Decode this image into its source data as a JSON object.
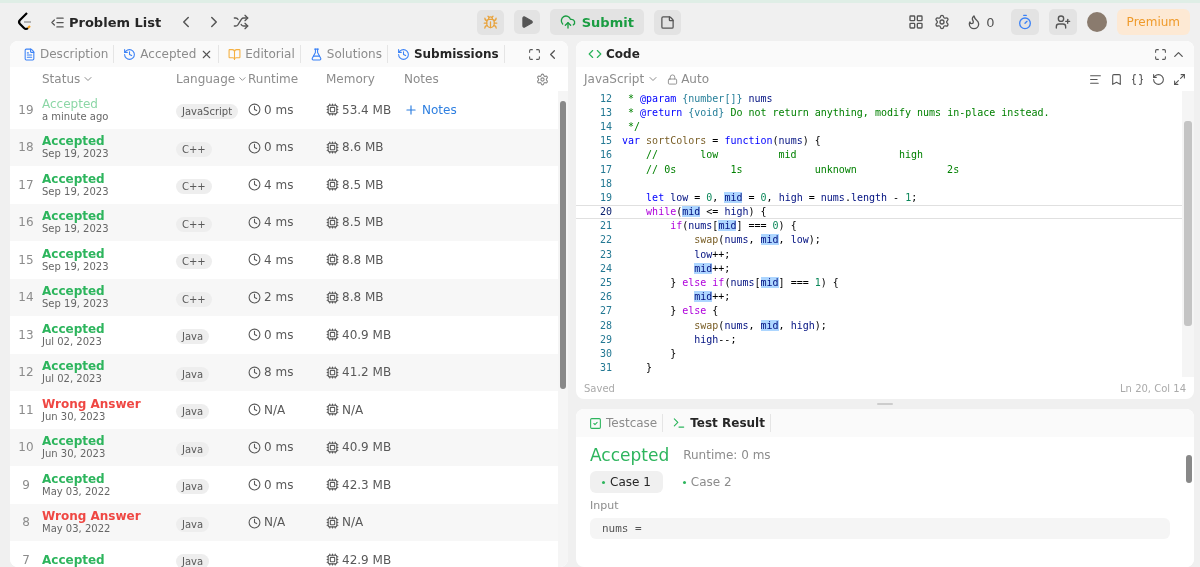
{
  "topbar": {
    "title": "Problem List",
    "submit": "Submit",
    "streak": "0",
    "premium": "Premium"
  },
  "left_panel": {
    "tabs": [
      {
        "label": "Description",
        "selected": false,
        "closable": false
      },
      {
        "label": "Accepted",
        "selected": false,
        "closable": true
      },
      {
        "label": "Editorial",
        "selected": false,
        "closable": false
      },
      {
        "label": "Solutions",
        "selected": false,
        "closable": false
      },
      {
        "label": "Submissions",
        "selected": true,
        "closable": false
      }
    ],
    "columns": [
      {
        "label": "Status",
        "sortable": true
      },
      {
        "label": "Language",
        "sortable": true
      },
      {
        "label": "Runtime",
        "sortable": false
      },
      {
        "label": "Memory",
        "sortable": false
      },
      {
        "label": "Notes",
        "sortable": false
      }
    ],
    "rows": [
      {
        "index": "19",
        "status": "Accepted",
        "kind": "accepted",
        "date": "a minute ago",
        "language": "JavaScript",
        "runtime": "0 ms",
        "memory": "53.4 MB",
        "notes": "Notes",
        "selected": true
      },
      {
        "index": "18",
        "status": "Accepted",
        "kind": "accepted",
        "date": "Sep 19, 2023",
        "language": "C++",
        "runtime": "0 ms",
        "memory": "8.6 MB",
        "selected": false
      },
      {
        "index": "17",
        "status": "Accepted",
        "kind": "accepted",
        "date": "Sep 19, 2023",
        "language": "C++",
        "runtime": "4 ms",
        "memory": "8.5 MB",
        "selected": false
      },
      {
        "index": "16",
        "status": "Accepted",
        "kind": "accepted",
        "date": "Sep 19, 2023",
        "language": "C++",
        "runtime": "4 ms",
        "memory": "8.5 MB",
        "selected": false
      },
      {
        "index": "15",
        "status": "Accepted",
        "kind": "accepted",
        "date": "Sep 19, 2023",
        "language": "C++",
        "runtime": "4 ms",
        "memory": "8.8 MB",
        "selected": false
      },
      {
        "index": "14",
        "status": "Accepted",
        "kind": "accepted",
        "date": "Sep 19, 2023",
        "language": "C++",
        "runtime": "2 ms",
        "memory": "8.8 MB",
        "selected": false
      },
      {
        "index": "13",
        "status": "Accepted",
        "kind": "accepted",
        "date": "Jul 02, 2023",
        "language": "Java",
        "runtime": "0 ms",
        "memory": "40.9 MB",
        "selected": false
      },
      {
        "index": "12",
        "status": "Accepted",
        "kind": "accepted",
        "date": "Jul 02, 2023",
        "language": "Java",
        "runtime": "8 ms",
        "memory": "41.2 MB",
        "selected": false
      },
      {
        "index": "11",
        "status": "Wrong Answer",
        "kind": "wrong",
        "date": "Jun 30, 2023",
        "language": "Java",
        "runtime": "N/A",
        "memory": "N/A",
        "selected": false
      },
      {
        "index": "10",
        "status": "Accepted",
        "kind": "accepted",
        "date": "Jun 30, 2023",
        "language": "Java",
        "runtime": "0 ms",
        "memory": "40.9 MB",
        "selected": false
      },
      {
        "index": "9",
        "status": "Accepted",
        "kind": "accepted",
        "date": "May 03, 2022",
        "language": "Java",
        "runtime": "0 ms",
        "memory": "42.3 MB",
        "selected": false
      },
      {
        "index": "8",
        "status": "Wrong Answer",
        "kind": "wrong",
        "date": "May 03, 2022",
        "language": "Java",
        "runtime": "N/A",
        "memory": "N/A",
        "selected": false
      },
      {
        "index": "7",
        "status": "Accepted",
        "kind": "accepted",
        "language": "Java",
        "memory": "42.9 MB",
        "selected": false
      }
    ]
  },
  "code_panel": {
    "title": "Code",
    "language": "JavaScript",
    "mode": "Auto",
    "status": "Saved",
    "cursor": "Ln 20, Col 14",
    "lines": [
      {
        "n": "12",
        "current": false,
        "tokens": [
          {
            "text": " * ",
            "kind": "comment"
          },
          {
            "text": "@param",
            "kind": "doctag"
          },
          {
            "text": " {number[]}",
            "kind": "type"
          },
          {
            "text": " nums",
            "kind": "variable"
          }
        ]
      },
      {
        "n": "13",
        "current": false,
        "tokens": [
          {
            "text": " * ",
            "kind": "comment"
          },
          {
            "text": "@return",
            "kind": "doctag"
          },
          {
            "text": " {void}",
            "kind": "type"
          },
          {
            "text": " Do not return anything, modify nums in-place instead.",
            "kind": "comment"
          }
        ]
      },
      {
        "n": "14",
        "current": false,
        "tokens": [
          {
            "text": " */",
            "kind": "comment"
          }
        ]
      },
      {
        "n": "15",
        "current": false,
        "tokens": [
          {
            "text": "var",
            "kind": "keyword"
          },
          {
            "text": " sortColors",
            "kind": "function"
          },
          {
            "text": " = ",
            "kind": "plain"
          },
          {
            "text": "function",
            "kind": "keyword"
          },
          {
            "text": "(",
            "kind": "plain"
          },
          {
            "text": "nums",
            "kind": "variable"
          },
          {
            "text": ") {",
            "kind": "plain"
          }
        ]
      },
      {
        "n": "16",
        "current": false,
        "tokens": [
          {
            "text": "    //       low          mid                 high",
            "kind": "comment"
          }
        ]
      },
      {
        "n": "17",
        "current": false,
        "tokens": [
          {
            "text": "    // 0s         1s            unknown               2s",
            "kind": "comment"
          }
        ]
      },
      {
        "n": "18",
        "current": false
      },
      {
        "n": "19",
        "current": false,
        "tokens": [
          {
            "text": "    let",
            "kind": "keyword"
          },
          {
            "text": " low",
            "kind": "variable"
          },
          {
            "text": " = ",
            "kind": "plain"
          },
          {
            "text": "0",
            "kind": "number"
          },
          {
            "text": ", ",
            "kind": "plain"
          },
          {
            "text": "mid",
            "kind": "match"
          },
          {
            "text": " = ",
            "kind": "plain"
          },
          {
            "text": "0",
            "kind": "number"
          },
          {
            "text": ", ",
            "kind": "plain"
          },
          {
            "text": "high",
            "kind": "variable"
          },
          {
            "text": " = ",
            "kind": "plain"
          },
          {
            "text": "nums",
            "kind": "variable"
          },
          {
            "text": ".",
            "kind": "plain"
          },
          {
            "text": "length",
            "kind": "variable"
          },
          {
            "text": " - ",
            "kind": "plain"
          },
          {
            "text": "1",
            "kind": "number"
          },
          {
            "text": ";",
            "kind": "plain"
          }
        ]
      },
      {
        "n": "20",
        "current": true,
        "tokens": [
          {
            "text": "    while",
            "kind": "control"
          },
          {
            "text": "(",
            "kind": "plain"
          },
          {
            "text": "mid",
            "kind": "match"
          },
          {
            "text": " <= ",
            "kind": "plain"
          },
          {
            "text": "high",
            "kind": "variable"
          },
          {
            "text": ") {",
            "kind": "plain"
          }
        ]
      },
      {
        "n": "21",
        "current": false,
        "tokens": [
          {
            "text": "        if",
            "kind": "control"
          },
          {
            "text": "(",
            "kind": "plain"
          },
          {
            "text": "nums",
            "kind": "variable"
          },
          {
            "text": "[",
            "kind": "plain"
          },
          {
            "text": "mid",
            "kind": "match"
          },
          {
            "text": "] === ",
            "kind": "plain"
          },
          {
            "text": "0",
            "kind": "number"
          },
          {
            "text": ") {",
            "kind": "plain"
          }
        ]
      },
      {
        "n": "22",
        "current": false,
        "tokens": [
          {
            "text": "            swap",
            "kind": "function"
          },
          {
            "text": "(",
            "kind": "plain"
          },
          {
            "text": "nums",
            "kind": "variable"
          },
          {
            "text": ", ",
            "kind": "plain"
          },
          {
            "text": "mid",
            "kind": "match"
          },
          {
            "text": ", ",
            "kind": "plain"
          },
          {
            "text": "low",
            "kind": "variable"
          },
          {
            "text": ");",
            "kind": "plain"
          }
        ]
      },
      {
        "n": "23",
        "current": false,
        "tokens": [
          {
            "text": "            low",
            "kind": "variable"
          },
          {
            "text": "++;",
            "kind": "plain"
          }
        ]
      },
      {
        "n": "24",
        "current": false,
        "tokens": [
          {
            "text": "            mid",
            "kind": "match"
          },
          {
            "text": "++;",
            "kind": "plain"
          }
        ]
      },
      {
        "n": "25",
        "current": false,
        "tokens": [
          {
            "text": "        } ",
            "kind": "plain"
          },
          {
            "text": "else if",
            "kind": "control"
          },
          {
            "text": "(",
            "kind": "plain"
          },
          {
            "text": "nums",
            "kind": "variable"
          },
          {
            "text": "[",
            "kind": "plain"
          },
          {
            "text": "mid",
            "kind": "match"
          },
          {
            "text": "] === ",
            "kind": "plain"
          },
          {
            "text": "1",
            "kind": "number"
          },
          {
            "text": ") {",
            "kind": "plain"
          }
        ]
      },
      {
        "n": "26",
        "current": false,
        "tokens": [
          {
            "text": "            mid",
            "kind": "match"
          },
          {
            "text": "++;",
            "kind": "plain"
          }
        ]
      },
      {
        "n": "27",
        "current": false,
        "tokens": [
          {
            "text": "        } ",
            "kind": "plain"
          },
          {
            "text": "else",
            "kind": "control"
          },
          {
            "text": " {",
            "kind": "plain"
          }
        ]
      },
      {
        "n": "28",
        "current": false,
        "tokens": [
          {
            "text": "            swap",
            "kind": "function"
          },
          {
            "text": "(",
            "kind": "plain"
          },
          {
            "text": "nums",
            "kind": "variable"
          },
          {
            "text": ", ",
            "kind": "plain"
          },
          {
            "text": "mid",
            "kind": "match"
          },
          {
            "text": ", ",
            "kind": "plain"
          },
          {
            "text": "high",
            "kind": "variable"
          },
          {
            "text": ");",
            "kind": "plain"
          }
        ]
      },
      {
        "n": "29",
        "current": false,
        "tokens": [
          {
            "text": "            high",
            "kind": "variable"
          },
          {
            "text": "--;",
            "kind": "plain"
          }
        ]
      },
      {
        "n": "30",
        "current": false,
        "tokens": [
          {
            "text": "        }",
            "kind": "plain"
          }
        ]
      },
      {
        "n": "31",
        "current": false,
        "tokens": [
          {
            "text": "    }",
            "kind": "plain"
          }
        ]
      }
    ]
  },
  "result_panel": {
    "tabs": [
      {
        "label": "Testcase",
        "selected": false
      },
      {
        "label": "Test Result",
        "selected": true
      }
    ],
    "verdict": "Accepted",
    "runtime": "Runtime: 0 ms",
    "cases": [
      {
        "label": "Case 1",
        "selected": true
      },
      {
        "label": "Case 2",
        "selected": false
      }
    ],
    "input_label": "Input",
    "input_value": "nums ="
  }
}
